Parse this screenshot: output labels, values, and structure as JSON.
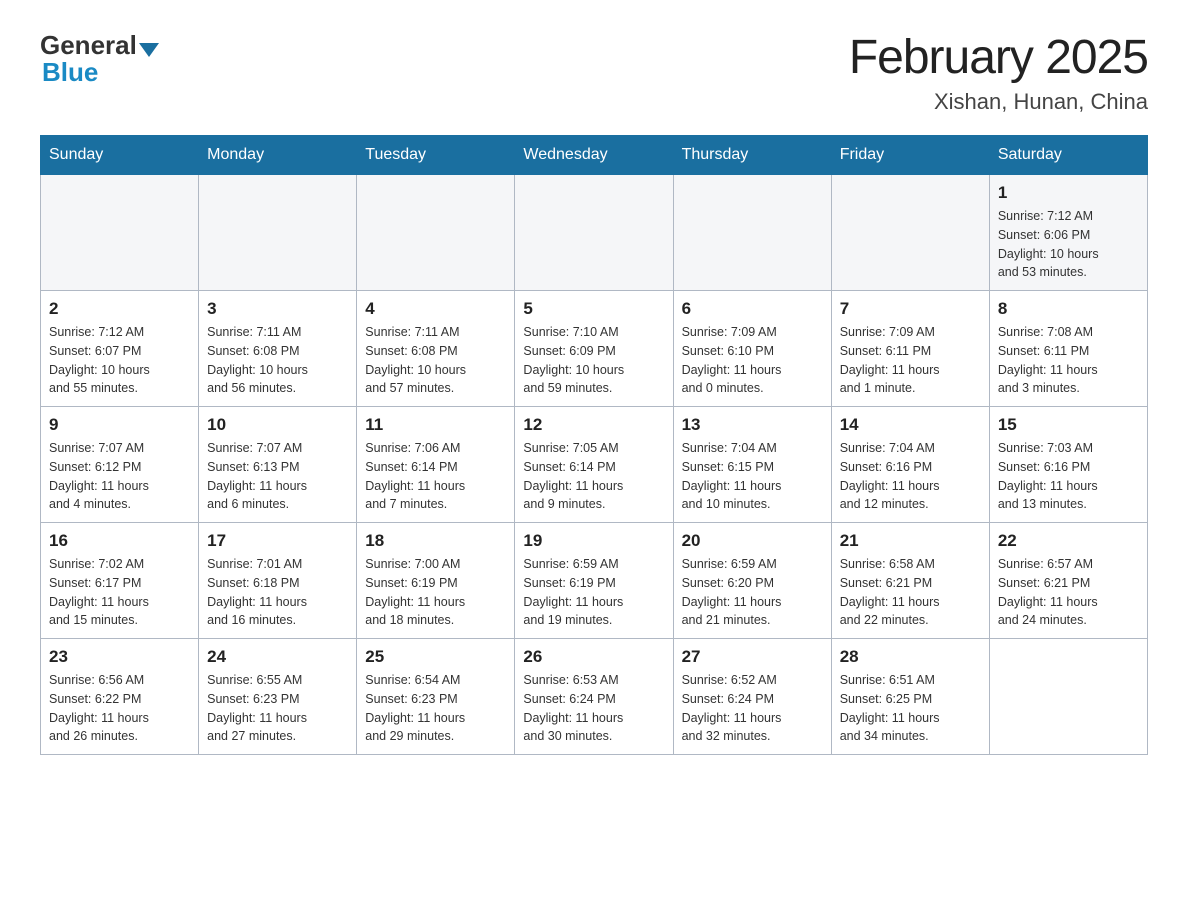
{
  "header": {
    "logo_general": "General",
    "logo_blue": "Blue",
    "month": "February 2025",
    "location": "Xishan, Hunan, China"
  },
  "weekdays": [
    "Sunday",
    "Monday",
    "Tuesday",
    "Wednesday",
    "Thursday",
    "Friday",
    "Saturday"
  ],
  "weeks": [
    [
      {
        "day": "",
        "info": ""
      },
      {
        "day": "",
        "info": ""
      },
      {
        "day": "",
        "info": ""
      },
      {
        "day": "",
        "info": ""
      },
      {
        "day": "",
        "info": ""
      },
      {
        "day": "",
        "info": ""
      },
      {
        "day": "1",
        "info": "Sunrise: 7:12 AM\nSunset: 6:06 PM\nDaylight: 10 hours\nand 53 minutes."
      }
    ],
    [
      {
        "day": "2",
        "info": "Sunrise: 7:12 AM\nSunset: 6:07 PM\nDaylight: 10 hours\nand 55 minutes."
      },
      {
        "day": "3",
        "info": "Sunrise: 7:11 AM\nSunset: 6:08 PM\nDaylight: 10 hours\nand 56 minutes."
      },
      {
        "day": "4",
        "info": "Sunrise: 7:11 AM\nSunset: 6:08 PM\nDaylight: 10 hours\nand 57 minutes."
      },
      {
        "day": "5",
        "info": "Sunrise: 7:10 AM\nSunset: 6:09 PM\nDaylight: 10 hours\nand 59 minutes."
      },
      {
        "day": "6",
        "info": "Sunrise: 7:09 AM\nSunset: 6:10 PM\nDaylight: 11 hours\nand 0 minutes."
      },
      {
        "day": "7",
        "info": "Sunrise: 7:09 AM\nSunset: 6:11 PM\nDaylight: 11 hours\nand 1 minute."
      },
      {
        "day": "8",
        "info": "Sunrise: 7:08 AM\nSunset: 6:11 PM\nDaylight: 11 hours\nand 3 minutes."
      }
    ],
    [
      {
        "day": "9",
        "info": "Sunrise: 7:07 AM\nSunset: 6:12 PM\nDaylight: 11 hours\nand 4 minutes."
      },
      {
        "day": "10",
        "info": "Sunrise: 7:07 AM\nSunset: 6:13 PM\nDaylight: 11 hours\nand 6 minutes."
      },
      {
        "day": "11",
        "info": "Sunrise: 7:06 AM\nSunset: 6:14 PM\nDaylight: 11 hours\nand 7 minutes."
      },
      {
        "day": "12",
        "info": "Sunrise: 7:05 AM\nSunset: 6:14 PM\nDaylight: 11 hours\nand 9 minutes."
      },
      {
        "day": "13",
        "info": "Sunrise: 7:04 AM\nSunset: 6:15 PM\nDaylight: 11 hours\nand 10 minutes."
      },
      {
        "day": "14",
        "info": "Sunrise: 7:04 AM\nSunset: 6:16 PM\nDaylight: 11 hours\nand 12 minutes."
      },
      {
        "day": "15",
        "info": "Sunrise: 7:03 AM\nSunset: 6:16 PM\nDaylight: 11 hours\nand 13 minutes."
      }
    ],
    [
      {
        "day": "16",
        "info": "Sunrise: 7:02 AM\nSunset: 6:17 PM\nDaylight: 11 hours\nand 15 minutes."
      },
      {
        "day": "17",
        "info": "Sunrise: 7:01 AM\nSunset: 6:18 PM\nDaylight: 11 hours\nand 16 minutes."
      },
      {
        "day": "18",
        "info": "Sunrise: 7:00 AM\nSunset: 6:19 PM\nDaylight: 11 hours\nand 18 minutes."
      },
      {
        "day": "19",
        "info": "Sunrise: 6:59 AM\nSunset: 6:19 PM\nDaylight: 11 hours\nand 19 minutes."
      },
      {
        "day": "20",
        "info": "Sunrise: 6:59 AM\nSunset: 6:20 PM\nDaylight: 11 hours\nand 21 minutes."
      },
      {
        "day": "21",
        "info": "Sunrise: 6:58 AM\nSunset: 6:21 PM\nDaylight: 11 hours\nand 22 minutes."
      },
      {
        "day": "22",
        "info": "Sunrise: 6:57 AM\nSunset: 6:21 PM\nDaylight: 11 hours\nand 24 minutes."
      }
    ],
    [
      {
        "day": "23",
        "info": "Sunrise: 6:56 AM\nSunset: 6:22 PM\nDaylight: 11 hours\nand 26 minutes."
      },
      {
        "day": "24",
        "info": "Sunrise: 6:55 AM\nSunset: 6:23 PM\nDaylight: 11 hours\nand 27 minutes."
      },
      {
        "day": "25",
        "info": "Sunrise: 6:54 AM\nSunset: 6:23 PM\nDaylight: 11 hours\nand 29 minutes."
      },
      {
        "day": "26",
        "info": "Sunrise: 6:53 AM\nSunset: 6:24 PM\nDaylight: 11 hours\nand 30 minutes."
      },
      {
        "day": "27",
        "info": "Sunrise: 6:52 AM\nSunset: 6:24 PM\nDaylight: 11 hours\nand 32 minutes."
      },
      {
        "day": "28",
        "info": "Sunrise: 6:51 AM\nSunset: 6:25 PM\nDaylight: 11 hours\nand 34 minutes."
      },
      {
        "day": "",
        "info": ""
      }
    ]
  ]
}
